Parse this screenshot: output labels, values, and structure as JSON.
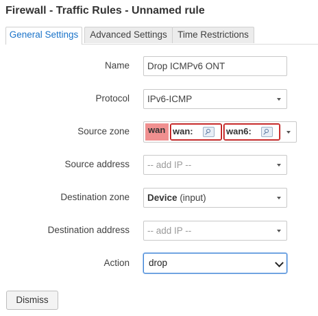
{
  "page": {
    "title": "Firewall - Traffic Rules - Unnamed rule"
  },
  "tabs": [
    {
      "label": "General Settings",
      "active": true
    },
    {
      "label": "Advanced Settings",
      "active": false
    },
    {
      "label": "Time Restrictions",
      "active": false
    }
  ],
  "form": {
    "name": {
      "label": "Name",
      "value": "Drop ICMPv6 ONT"
    },
    "protocol": {
      "label": "Protocol",
      "value": "IPv6-ICMP"
    },
    "source_zone": {
      "label": "Source zone",
      "zone": "wan",
      "networks": [
        "wan:",
        "wan6:"
      ]
    },
    "source_address": {
      "label": "Source address",
      "placeholder": "-- add IP --"
    },
    "destination_zone": {
      "label": "Destination zone",
      "value": "Device",
      "suffix": "(input)"
    },
    "destination_address": {
      "label": "Destination address",
      "placeholder": "-- add IP --"
    },
    "action": {
      "label": "Action",
      "value": "drop"
    }
  },
  "buttons": {
    "dismiss": "Dismiss"
  },
  "colors": {
    "accent": "#1a73c9",
    "zone_wan": "#f09090",
    "chip_border": "#b00000"
  }
}
